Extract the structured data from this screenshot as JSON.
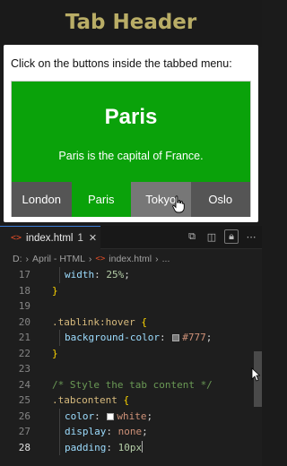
{
  "header": {
    "title": "Tab Header"
  },
  "demo": {
    "instructions": "Click on the buttons inside the tabbed menu:",
    "content": {
      "city": "Paris",
      "description": "Paris is the capital of France.",
      "color": "#0aa20a"
    },
    "tabs": [
      {
        "label": "London",
        "color": "#555555"
      },
      {
        "label": "Paris",
        "color": "#0aa20a",
        "active": true
      },
      {
        "label": "Tokyo",
        "color": "#777777",
        "hovered": true
      },
      {
        "label": "Oslo",
        "color": "#555555"
      }
    ]
  },
  "editor": {
    "tab": {
      "filename": "index.html",
      "number": "1",
      "icon": "html-file-icon"
    },
    "breadcrumb": {
      "drive": "D:",
      "folder": "April - HTML",
      "file": "index.html",
      "more": "..."
    },
    "lines": [
      {
        "num": "17",
        "text": "width: 25%;"
      },
      {
        "num": "18",
        "text": "}"
      },
      {
        "num": "19",
        "text": ""
      },
      {
        "num": "20",
        "text": ".tablink:hover {"
      },
      {
        "num": "21",
        "text": "background-color: #777;"
      },
      {
        "num": "22",
        "text": "}"
      },
      {
        "num": "23",
        "text": ""
      },
      {
        "num": "24",
        "text": "/* Style the tab content */"
      },
      {
        "num": "25",
        "text": ".tabcontent {"
      },
      {
        "num": "26",
        "text": "color: white;"
      },
      {
        "num": "27",
        "text": "display: none;"
      },
      {
        "num": "28",
        "text": "padding: 10px"
      }
    ],
    "tokens": {
      "width": "width",
      "w25": "25%",
      "hover_sel": ".tablink:hover",
      "bg": "background-color",
      "c777": "#777",
      "comment": "/* Style the tab content */",
      "tc_sel": ".tabcontent",
      "color": "color",
      "white": "white",
      "display": "display",
      "none": "none",
      "padding": "padding",
      "p10": "10px"
    },
    "colors": {
      "swatch_777": "#777777",
      "swatch_white": "#ffffff"
    }
  }
}
